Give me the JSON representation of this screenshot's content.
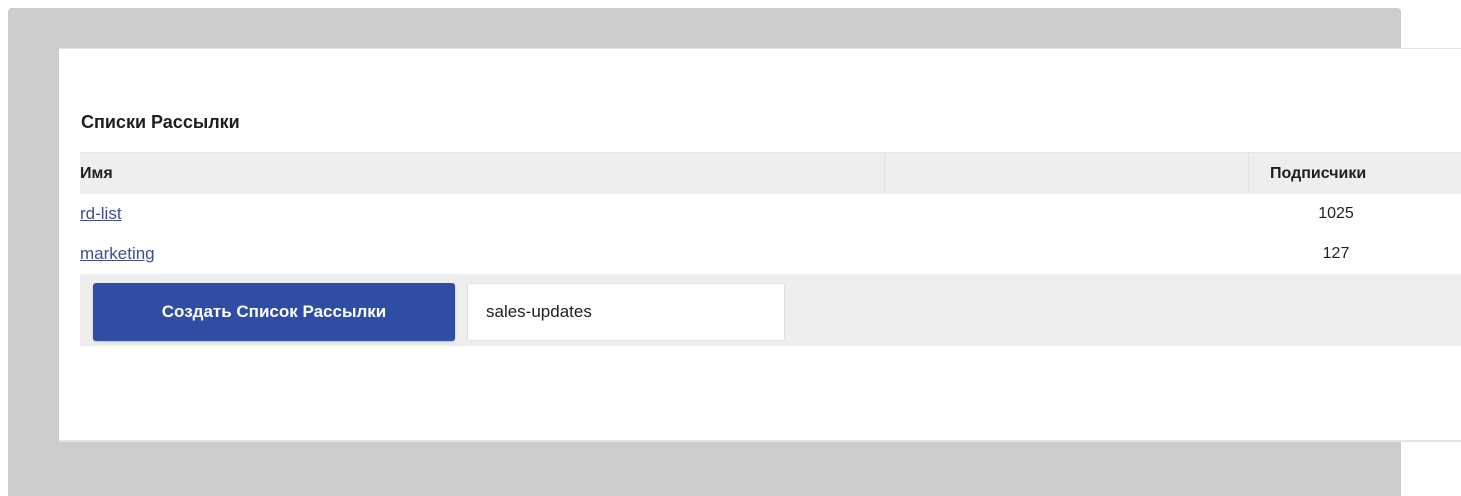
{
  "section": {
    "title": "Списки Рассылки"
  },
  "table": {
    "columns": {
      "name": "Имя",
      "subscribers": "Подписчики"
    },
    "rows": [
      {
        "name": "rd-list",
        "subscribers": "1025"
      },
      {
        "name": "marketing",
        "subscribers": "127"
      }
    ]
  },
  "create": {
    "button_label": "Создать Список Рассылки",
    "input_value": "sales-updates"
  },
  "colors": {
    "backdrop": "#cdcdcd",
    "button_bg": "#2f4da3",
    "link": "#3f4f8c",
    "header_bg": "#eeeeee"
  }
}
